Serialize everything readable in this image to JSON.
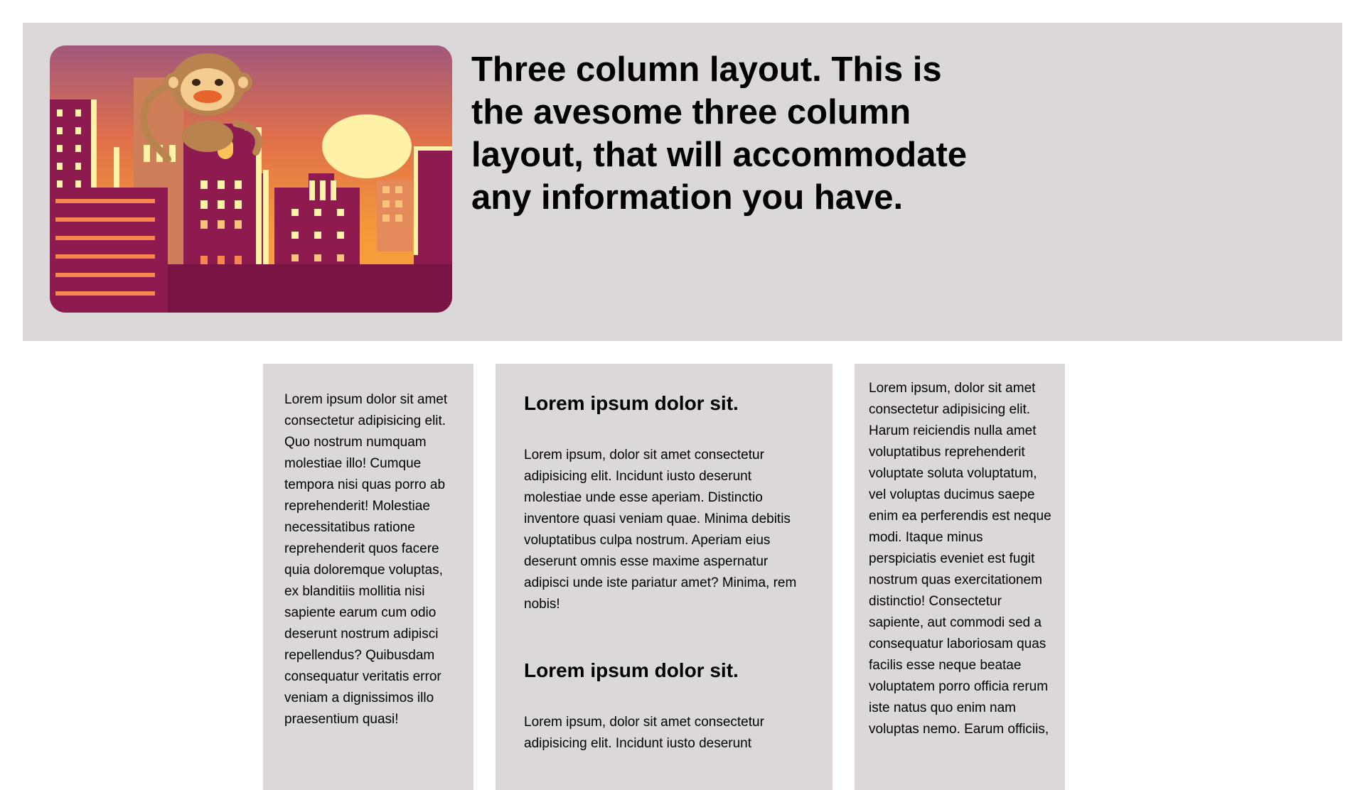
{
  "header": {
    "headline": "Three column layout. This is the avesome three column layout, that will accommodate any information you have.",
    "image_icon": "city-sunset-monkey-illustration",
    "colors": {
      "panel_bg": "#dcd8d9",
      "sky_top": "#a1587c",
      "sky_bottom": "#f59a3a",
      "building": "#8d1b4f",
      "sun": "#fff1a6"
    }
  },
  "columns": {
    "left": {
      "text": "Lorem ipsum dolor sit amet consectetur adipisicing elit. Quo nostrum numquam molestiae illo! Cumque tempora nisi quas porro ab reprehenderit! Molestiae necessitatibus ratione reprehenderit quos facere quia doloremque voluptas, ex blanditiis mollitia nisi sapiente earum cum odio deserunt nostrum adipisci repellendus? Quibusdam consequatur veritatis error veniam a dignissimos illo praesentium quasi!"
    },
    "middle": {
      "sections": [
        {
          "heading": "Lorem ipsum dolor sit.",
          "text": "Lorem ipsum, dolor sit amet consectetur adipisicing elit. Incidunt iusto deserunt molestiae unde esse aperiam. Distinctio inventore quasi veniam quae. Minima debitis voluptatibus culpa nostrum. Aperiam eius deserunt omnis esse maxime aspernatur adipisci unde iste pariatur amet? Minima, rem nobis!"
        },
        {
          "heading": "Lorem ipsum dolor sit.",
          "text": "Lorem ipsum, dolor sit amet consectetur adipisicing elit. Incidunt iusto deserunt"
        }
      ]
    },
    "right": {
      "text": "Lorem ipsum, dolor sit amet consectetur adipisicing elit. Harum reiciendis nulla amet voluptatibus reprehenderit voluptate soluta voluptatum, vel voluptas ducimus saepe enim ea perferendis est neque modi. Itaque minus perspiciatis eveniet est fugit nostrum quas exercitationem distinctio! Consectetur sapiente, aut commodi sed a consequatur laboriosam quas facilis esse neque beatae voluptatem porro officia rerum iste natus quo enim nam voluptas nemo. Earum officiis,"
    }
  }
}
